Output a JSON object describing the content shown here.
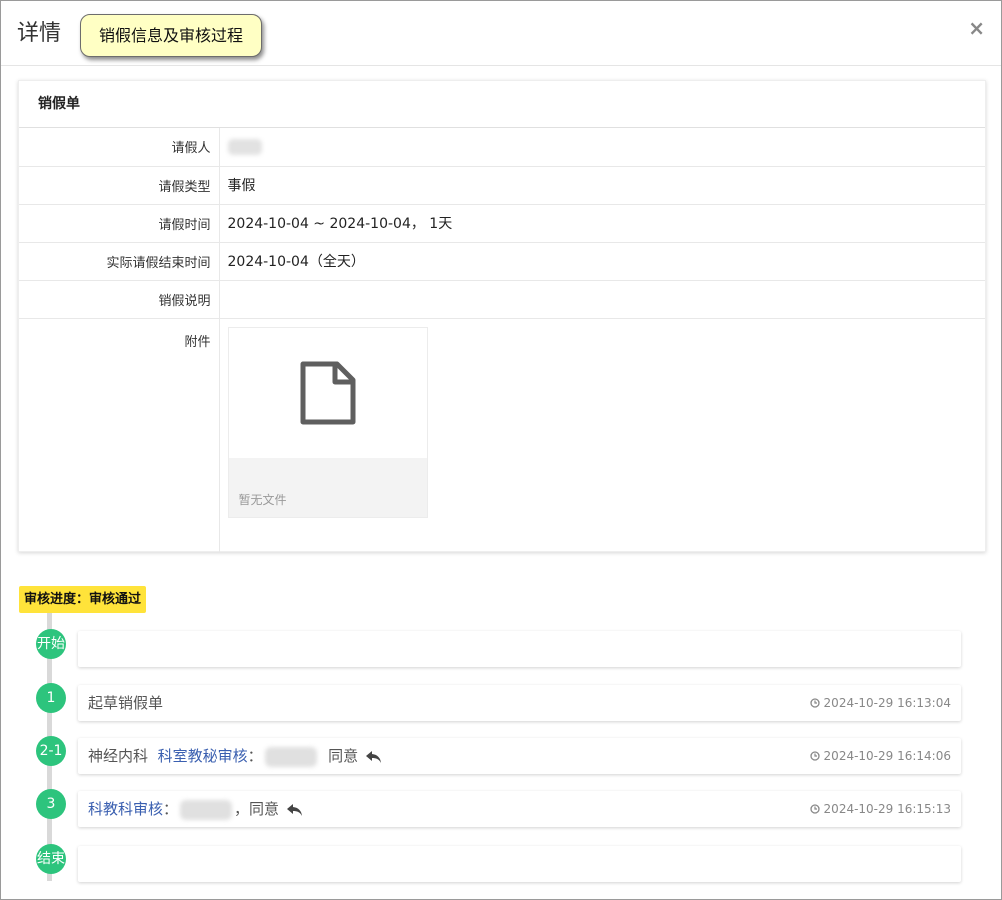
{
  "dialog": {
    "title": "详情",
    "tip": "销假信息及审核过程",
    "close": "×"
  },
  "panel": {
    "heading": "销假单",
    "rows": [
      {
        "label": "请假人",
        "value": ""
      },
      {
        "label": "请假类型",
        "value": "事假"
      },
      {
        "label": "请假时间",
        "value": "2024-10-04 ~ 2024-10-04， 1天"
      },
      {
        "label": "实际请假结束时间",
        "value": "2024-10-04（全天）"
      },
      {
        "label": "销假说明",
        "value": ""
      },
      {
        "label": "附件",
        "value": ""
      }
    ],
    "attachment": {
      "icon": "file-icon",
      "empty_text": "暂无文件"
    }
  },
  "progress": {
    "badge": "审核进度：审核通过",
    "nodes": [
      {
        "marker": "开始",
        "text": "",
        "time": ""
      },
      {
        "marker": "1",
        "text": "起草销假单",
        "time": "2024-10-29 16:13:04"
      },
      {
        "marker": "2-1",
        "dept": "神经内科",
        "role": "科室教秘审核",
        "sep": "：",
        "result": "同意",
        "time": "2024-10-29 16:14:06"
      },
      {
        "marker": "3",
        "role": "科教科审核",
        "sep": "：",
        "result": "，同意",
        "time": "2024-10-29 16:15:13"
      },
      {
        "marker": "结束",
        "text": "",
        "time": ""
      }
    ]
  },
  "colors": {
    "node": "#2dc47d",
    "badge": "#ffe33a",
    "tip": "#ffffc4",
    "role_link": "#3a5fb0"
  },
  "icons": [
    "close-icon",
    "file-icon",
    "clock-icon",
    "reply-icon"
  ]
}
